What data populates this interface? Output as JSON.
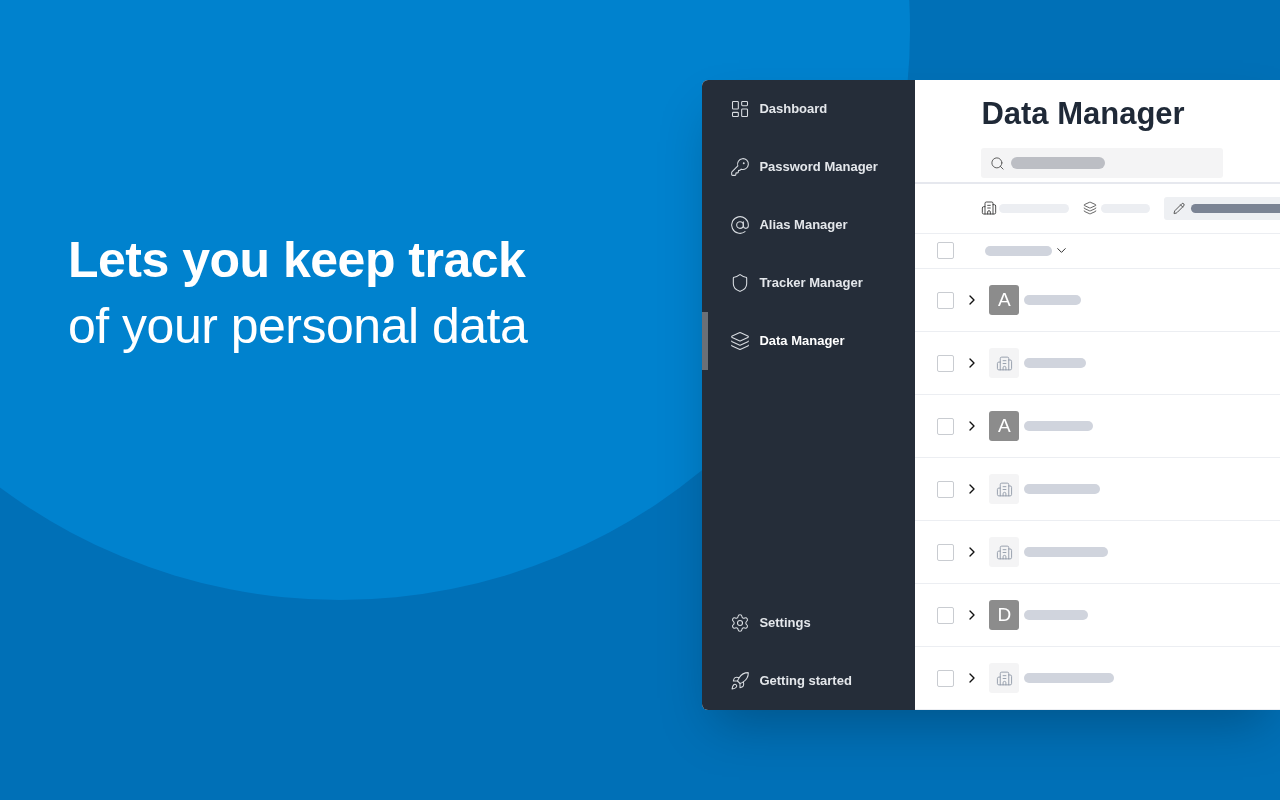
{
  "headline": {
    "bold": "Lets you keep track",
    "regular": "of your personal data"
  },
  "sidebar": {
    "items": [
      {
        "kind": "dashboard",
        "label": "Dashboard",
        "selected": false
      },
      {
        "kind": "password",
        "label": "Password Manager",
        "selected": false
      },
      {
        "kind": "alias",
        "label": "Alias Manager",
        "selected": false
      },
      {
        "kind": "tracker",
        "label": "Tracker Manager",
        "selected": false
      },
      {
        "kind": "data",
        "label": "Data Manager",
        "selected": true
      }
    ],
    "bottom_items": [
      {
        "kind": "settings",
        "label": "Settings",
        "selected": false
      },
      {
        "kind": "start",
        "label": "Getting started",
        "selected": false
      }
    ]
  },
  "main": {
    "title": "Data Manager",
    "select_all": {
      "checked": false
    },
    "rows": [
      {
        "kind": "letter",
        "letter": "A",
        "checked": false,
        "expanded": false
      },
      {
        "kind": "org",
        "checked": false,
        "expanded": false
      },
      {
        "kind": "letter",
        "letter": "A",
        "checked": false,
        "expanded": false
      },
      {
        "kind": "org",
        "checked": false,
        "expanded": false
      },
      {
        "kind": "org",
        "checked": false,
        "expanded": false
      },
      {
        "kind": "letter",
        "letter": "D",
        "checked": false,
        "expanded": false
      },
      {
        "kind": "org",
        "checked": false,
        "expanded": false
      }
    ]
  }
}
